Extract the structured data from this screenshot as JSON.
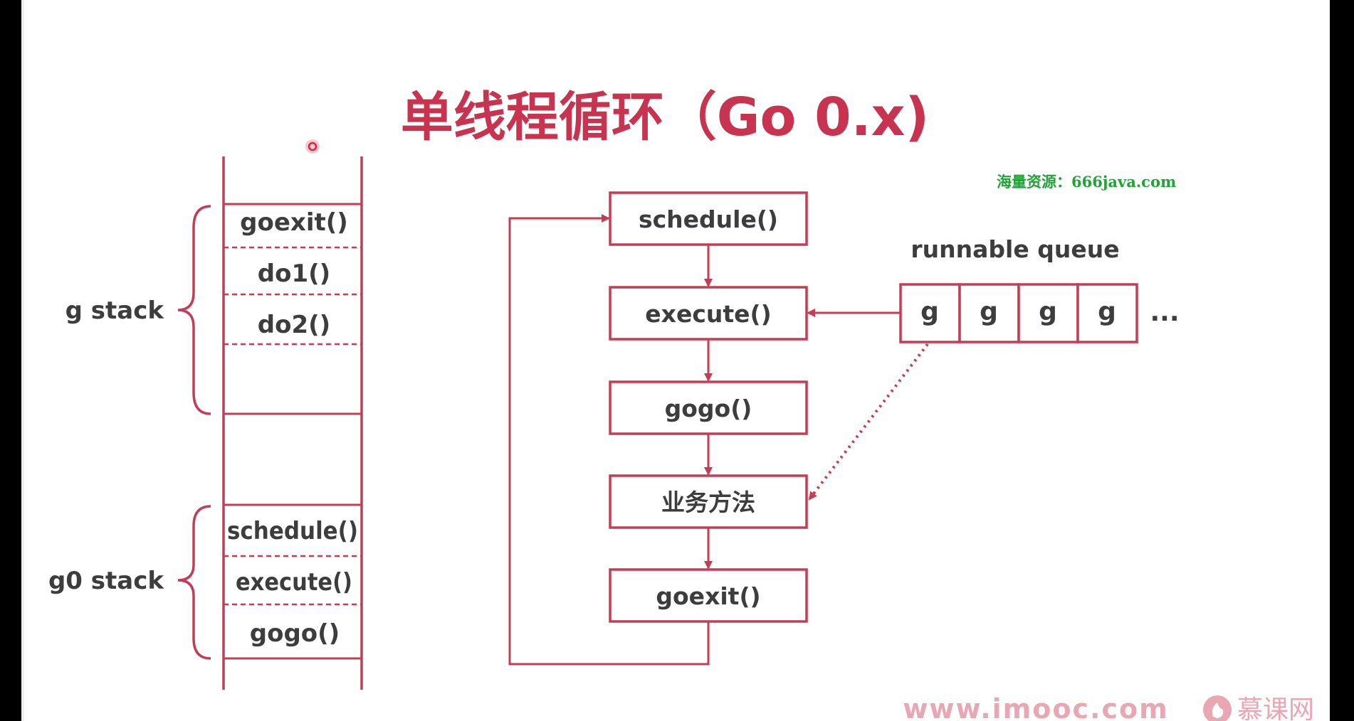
{
  "slide": {
    "title": "单线程循环（Go 0.x)",
    "watermark": "海量资源：666java.com",
    "footer": {
      "site": "www.imooc.com",
      "brand": "慕课网"
    }
  },
  "left_stacks": {
    "g_stack": {
      "label": "g stack",
      "frames": [
        "goexit()",
        "do1()",
        "do2()"
      ]
    },
    "g0_stack": {
      "label": "g0 stack",
      "frames": [
        "schedule()",
        "execute()",
        "gogo()"
      ]
    }
  },
  "flow": {
    "boxes": [
      "schedule()",
      "execute()",
      "gogo()",
      "业务方法",
      "goexit()"
    ]
  },
  "queue": {
    "label": "runnable queue",
    "items": [
      "g",
      "g",
      "g",
      "g"
    ],
    "ellipsis": "..."
  },
  "colors": {
    "accent": "#c8334f",
    "line": "#c43d57",
    "text": "#3d3d3d",
    "watermark": "#22a33a",
    "footer": "#e8a7b3",
    "background": "#ffffff"
  }
}
